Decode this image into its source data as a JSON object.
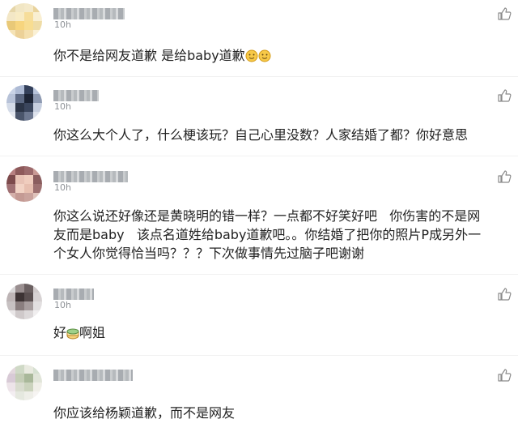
{
  "comments": [
    {
      "time": "10h",
      "text_parts": [
        "你不是给网友道歉 是给baby道歉"
      ],
      "emoji": [
        "smiley-emoji",
        "smiley-emoji"
      ],
      "avatar_colors": [
        "#e6d6a8",
        "#f1e6c4",
        "#f4e9c9",
        "#e9d39c",
        "#f3e7c6",
        "#f8ebc4",
        "#f6dd9a",
        "#f9efd2",
        "#e9c978",
        "#f7d57e",
        "#f8dd91",
        "#efdca6",
        "#f5e3b6",
        "#ecd198",
        "#f4dfae",
        "#faf0d4"
      ]
    },
    {
      "time": "10h",
      "text_parts": [
        "你这么大个人了，什么梗该玩？自己心里没数？人家结婚了都？你好意思"
      ],
      "avatar_colors": [
        "#c9d3e6",
        "#aebbd5",
        "#34405a",
        "#b7c3da",
        "#b7c2d8",
        "#5c6882",
        "#1d2435",
        "#8e9ab2",
        "#d4dbe8",
        "#2c3547",
        "#3b465d",
        "#c7cfdf",
        "#e3e7ef",
        "#4a556b",
        "#6d7890",
        "#dde2ec"
      ]
    },
    {
      "time": "10h",
      "text_parts": [
        "你这么说还好像还是黄晓明的错一样？一点都不好笑好吧   你伤害的不是网",
        "友而是baby   该点名道姓给baby道歉吧。。你结婚了把你的照片P成另外一",
        "个女人你觉得恰当吗？？？下次做事情先过脑子吧谢谢"
      ],
      "avatar_colors": [
        "#b77f80",
        "#8e5a5b",
        "#9c6a6c",
        "#c99a95",
        "#7d4a4c",
        "#e8c2b5",
        "#f0cdbe",
        "#8a5d5e",
        "#a07073",
        "#f2d3c5",
        "#e7bfb0",
        "#9d7070",
        "#d4b0aa",
        "#c49a94",
        "#caa39d",
        "#dfc3bb"
      ]
    },
    {
      "time": "10h",
      "text_parts": [
        "好",
        "啊姐"
      ],
      "emoji": [
        "cake-emoji"
      ],
      "avatar_colors": [
        "#d9d7d8",
        "#9a8f90",
        "#6b6061",
        "#cfc9ca",
        "#bdb4b5",
        "#3d3334",
        "#5a4f50",
        "#d7d2d3",
        "#c7c1c2",
        "#8a7e7f",
        "#a79d9e",
        "#e2dfe0",
        "#e9e6e7",
        "#cfc9ca",
        "#dcd8d9",
        "#f0eeef"
      ]
    },
    {
      "time": "",
      "text_parts": [
        "你应该给杨颖道歉，而不是网友"
      ],
      "avatar_colors": [
        "#e3d8dd",
        "#cfd9c6",
        "#e9eae0",
        "#d6e0d1",
        "#d8cad6",
        "#c4cdb6",
        "#a9b89a",
        "#e1e5d9",
        "#ede4e9",
        "#d9dccf",
        "#cbd3bd",
        "#f0efe8",
        "#f3eef1",
        "#e5e8df",
        "#eeeee8",
        "#f6f4f2"
      ]
    }
  ]
}
